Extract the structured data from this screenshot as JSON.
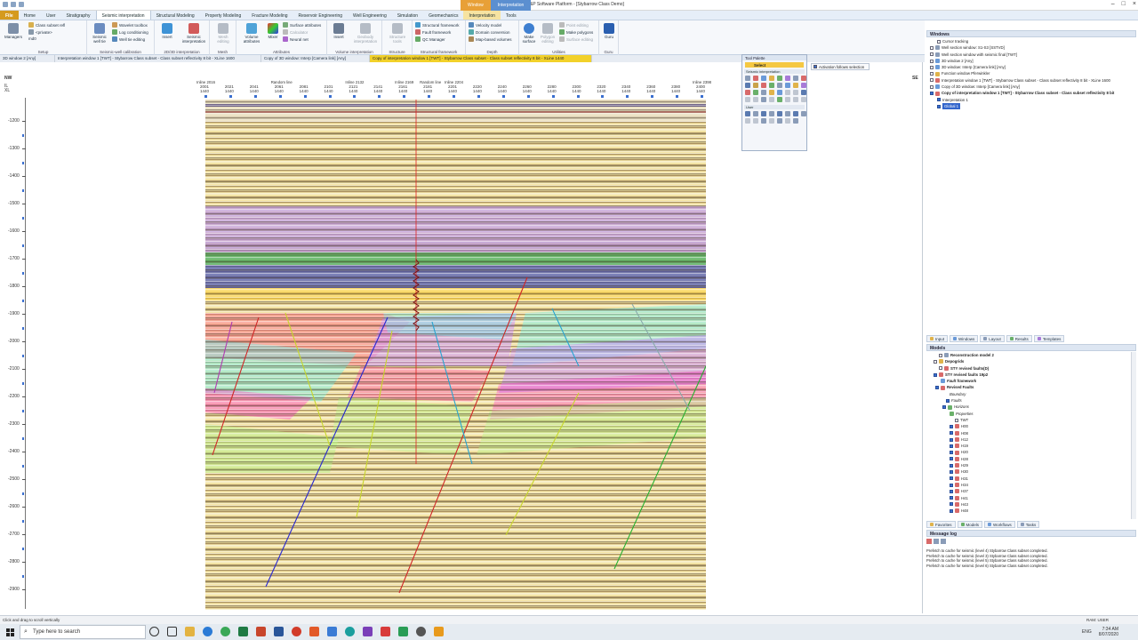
{
  "window": {
    "title": "Petrel E&P Software Platform - [Stybarrow Class Demo]",
    "context_tabs": [
      "Window",
      "Interpretation"
    ]
  },
  "ribbon_tabs": [
    "File",
    "Home",
    "Seismic interpretation",
    "Stratigraphy",
    "Seismic interpretation",
    "Structural Modeling",
    "Property Modeling",
    "Fracture Modeling",
    "Reservoir Engineering",
    "Well Engineering",
    "Simulation",
    "Geomechanics",
    "Interpretation",
    "Tools"
  ],
  "ribbon": {
    "groups": [
      {
        "label": "Setup"
      },
      {
        "label": "Seismic-well calibration"
      },
      {
        "label": "2D/3D interpretation"
      },
      {
        "label": "Mesh"
      },
      {
        "label": "Attributes"
      },
      {
        "label": "Volume interpretation"
      },
      {
        "label": "Structure"
      },
      {
        "label": "Structural framework"
      },
      {
        "label": "Depth"
      },
      {
        "label": "Utilities"
      },
      {
        "label": "Guru"
      }
    ],
    "managers": "Managers",
    "class_subset": "Class subset refl",
    "private": "<private>",
    "md": "md0",
    "seismic_well_tie": "Seismic well tie",
    "wavelet_toolbox": "Wavelet toolbox",
    "log_conditioning": "Log conditioning",
    "well_tie_editing": "Well tie editing",
    "insert": "Insert",
    "seismic_interpretation": "Seismic interpretation",
    "mesh_editing": "Mesh editing",
    "volume_attributes": "Volume attributes",
    "mixer": "Mixer",
    "surface_attributes": "Surface attributes",
    "calculator": "Calculator",
    "neural_net": "Neural net",
    "insert2": "Insert",
    "geobody_interpretation": "Geobody interpretation",
    "structure_tools": "Structure tools",
    "structural_framework": "Structural framework",
    "fault_framework": "Fault framework",
    "qc_manager": "QC Manager",
    "velocity_model": "Velocity model",
    "domain_conversion": "Domain conversion",
    "map_based_volumes": "Map-based volumes",
    "make_surface": "Make surface",
    "polygon_editing": "Polygon editing",
    "point_editing": "Point editing",
    "make_polygons": "Make polygons",
    "surface_editing": "Surface editing",
    "guru": "Guru"
  },
  "doc_tabs": [
    "3D window 2 [Any]",
    "Interpretation window 1 [TWT] - Stybarrow Class subset - Class subset reflectivity 8 bit - XLine 1600",
    "Copy of 3D window: Interp [Camera link] [Any]",
    "Copy of interpretation window 1 [TWT] - Stybarrow Class subset - Class subset reflectivity 8 bit - XLine 1440"
  ],
  "section": {
    "left_dir": "NW",
    "right_dir": "SE",
    "left_labels": [
      "IL",
      "XL"
    ],
    "top_labels": [
      {
        "name": "Inline 2016",
        "il": "2001",
        "xl": "1440"
      },
      {
        "name": "",
        "il": "2021",
        "xl": "1440"
      },
      {
        "name": "",
        "il": "2041",
        "xl": "1440"
      },
      {
        "name": "Random line",
        "il": "2061",
        "xl": "1440"
      },
      {
        "name": "",
        "il": "2081",
        "xl": "1440"
      },
      {
        "name": "",
        "il": "2101",
        "xl": "1440"
      },
      {
        "name": "Inline 2132",
        "il": "2121",
        "xl": "1440"
      },
      {
        "name": "",
        "il": "2141",
        "xl": "1440"
      },
      {
        "name": "Inline 2169",
        "il": "2161",
        "xl": "1440"
      },
      {
        "name": "Random line",
        "il": "2181",
        "xl": "1440"
      },
      {
        "name": "Inline 2204",
        "il": "2201",
        "xl": "1440"
      },
      {
        "name": "",
        "il": "2220",
        "xl": "1440"
      },
      {
        "name": "",
        "il": "2240",
        "xl": "1440"
      },
      {
        "name": "",
        "il": "2260",
        "xl": "1440"
      },
      {
        "name": "",
        "il": "2280",
        "xl": "1440"
      },
      {
        "name": "",
        "il": "2300",
        "xl": "1440"
      },
      {
        "name": "",
        "il": "2320",
        "xl": "1440"
      },
      {
        "name": "",
        "il": "2340",
        "xl": "1440"
      },
      {
        "name": "",
        "il": "2360",
        "xl": "1440"
      },
      {
        "name": "",
        "il": "2380",
        "xl": "1440"
      },
      {
        "name": "Inline 2398",
        "il": "2400",
        "xl": "1440"
      }
    ],
    "depth_ticks": [
      "-1200",
      "-1300",
      "-1400",
      "-1500",
      "-1600",
      "-1700",
      "-1800",
      "-1900",
      "-2000",
      "-2100",
      "-2200",
      "-2300",
      "-2400",
      "-2500",
      "-2600",
      "-2700",
      "-2800",
      "-2900"
    ]
  },
  "tool_palette": {
    "title": "Tool Palette",
    "select": "Select",
    "section1": "Seismic interpretation",
    "section2": "User",
    "activation": "Activation follows selection"
  },
  "windows_panel": {
    "title": "Windows",
    "items": [
      "Cursor tracking",
      "Well section window: S1-S3 [SSTVD]",
      "Well section window with seismic final [TWT]",
      "3D window 2 [Any]",
      "3D window: Interp [Camera link] [Any]",
      "Function window Pferwinkler",
      "Interpretation window 1 [TWT] - Stybarrow Class subset - Class subset reflectivity 8 bit - XLine 1600",
      "Copy of 3D window: Interp [Camera link] [Any]",
      "Copy of interpretation window 1 [TWT] - Stybarrow Class subset - Class subset reflectivity 8 bit",
      "Interpretation 1",
      "Global 1"
    ]
  },
  "panel_tabs": [
    "Input",
    "Windows",
    "Layout",
    "Results",
    "Templates"
  ],
  "models_panel": {
    "title": "Models",
    "items": [
      "Reconstruction model 2",
      "Depogrids",
      "STY revised faults(D)",
      "STY revised faults 19p2",
      "Fault framework",
      "Revised Faults",
      "Boundary",
      "Faults",
      "Horizons",
      "Properties",
      "TWT",
      "H00",
      "H08",
      "H12",
      "H19",
      "H20",
      "H28",
      "H29",
      "H30",
      "H31",
      "H34",
      "H37",
      "H41",
      "H43",
      "H48"
    ]
  },
  "bottom_tabs": [
    "Favorites",
    "Models",
    "Workflows",
    "Tasks"
  ],
  "message_log": {
    "title": "Message log",
    "lines": [
      "Prefetch to cache for seismic (level 4) Stybarrow Class subset completed.",
      "Prefetch to cache for seismic (level 3) Stybarrow Class subset completed.",
      "Prefetch to cache for seismic (level 5) Stybarrow Class subset completed.",
      "Prefetch to cache for seismic (level 6) Stybarrow Class subset completed."
    ]
  },
  "status": {
    "left": "Click and drag to scroll vertically",
    "right": "RAM: USER"
  },
  "taskbar": {
    "search_placeholder": "Type here to search",
    "time": "7:34 AM",
    "date": "8/07/2020",
    "lang": "ENG"
  },
  "colors": {
    "file_tab": "#d59a1e",
    "active_doc_tab": "#f2d12a",
    "selection": "#3366cc"
  }
}
